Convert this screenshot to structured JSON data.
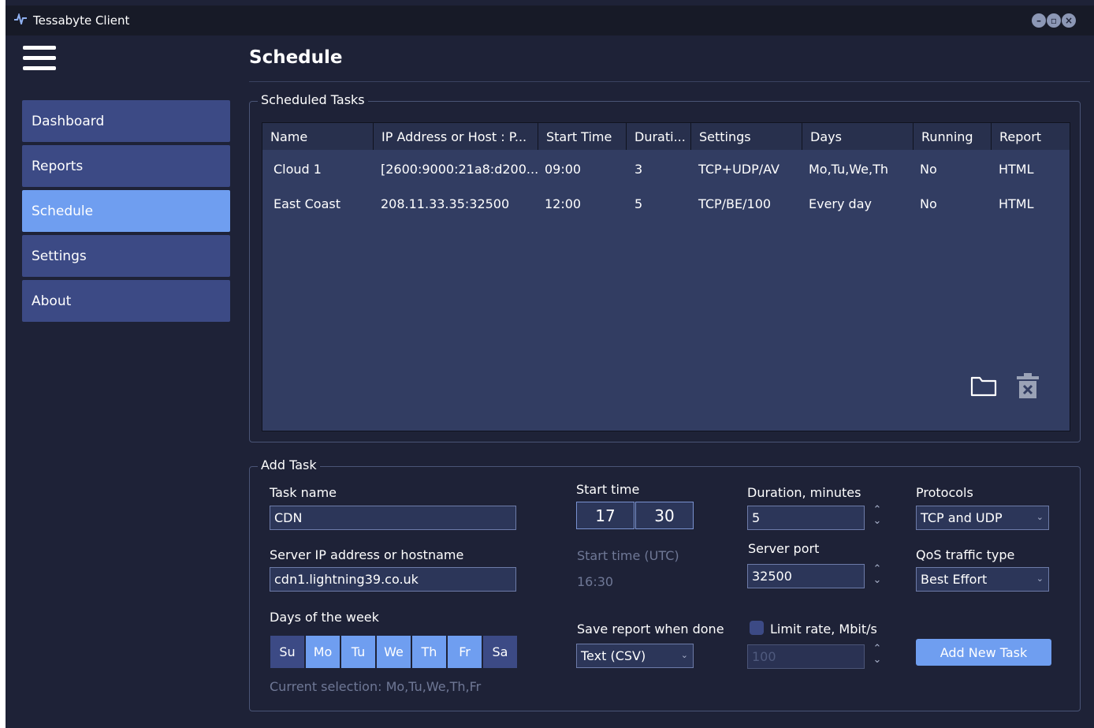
{
  "window": {
    "title": "Tessabyte Client",
    "controls": [
      "minimize",
      "maximize",
      "close"
    ]
  },
  "header": {
    "page_title": "Schedule"
  },
  "sidebar": {
    "items": [
      {
        "label": "Dashboard",
        "active": false
      },
      {
        "label": "Reports",
        "active": false
      },
      {
        "label": "Schedule",
        "active": true
      },
      {
        "label": "Settings",
        "active": false
      },
      {
        "label": "About",
        "active": false
      }
    ]
  },
  "scheduled_tasks": {
    "title": "Scheduled Tasks",
    "columns": [
      "Name",
      "IP Address or Host : P...",
      "Start Time",
      "Durati...",
      "Settings",
      "Days",
      "Running",
      "Report"
    ],
    "rows": [
      [
        "Cloud 1",
        "[2600:9000:21a8:d200...",
        "09:00",
        "3",
        "TCP+UDP/AV",
        "Mo,Tu,We,Th",
        "No",
        "HTML"
      ],
      [
        "East Coast",
        "208.11.33.35:32500",
        "12:00",
        "5",
        "TCP/BE/100",
        "Every day",
        "No",
        "HTML"
      ]
    ],
    "icons": [
      "folder-icon",
      "trash-icon"
    ]
  },
  "add_task": {
    "title": "Add Task",
    "task_name_label": "Task name",
    "task_name_value": "CDN",
    "server_label": "Server IP address or hostname",
    "server_value": "cdn1.lightning39.co.uk",
    "days_label": "Days of the week",
    "days": [
      {
        "label": "Su",
        "selected": false
      },
      {
        "label": "Mo",
        "selected": true
      },
      {
        "label": "Tu",
        "selected": true
      },
      {
        "label": "We",
        "selected": true
      },
      {
        "label": "Th",
        "selected": true
      },
      {
        "label": "Fr",
        "selected": true
      },
      {
        "label": "Sa",
        "selected": false
      }
    ],
    "current_selection": "Current selection: Mo,Tu,We,Th,Fr",
    "start_time_label": "Start time",
    "start_hour": "17",
    "start_minute": "30",
    "start_utc_label": "Start time (UTC)",
    "start_utc_value": "16:30",
    "save_report_label": "Save report when done",
    "save_report_value": "Text (CSV)",
    "duration_label": "Duration, minutes",
    "duration_value": "5",
    "server_port_label": "Server port",
    "server_port_value": "32500",
    "limit_rate_label": "Limit rate, Mbit/s",
    "limit_rate_value": "100",
    "limit_rate_checked": false,
    "protocols_label": "Protocols",
    "protocols_value": "TCP and UDP",
    "qos_label": "QoS traffic type",
    "qos_value": "Best Effort",
    "add_button_label": "Add New Task"
  },
  "colors": {
    "background": "#1e2237",
    "accent": "#6f9ef0",
    "button": "#3c4a85",
    "table_bg": "#323d62"
  }
}
